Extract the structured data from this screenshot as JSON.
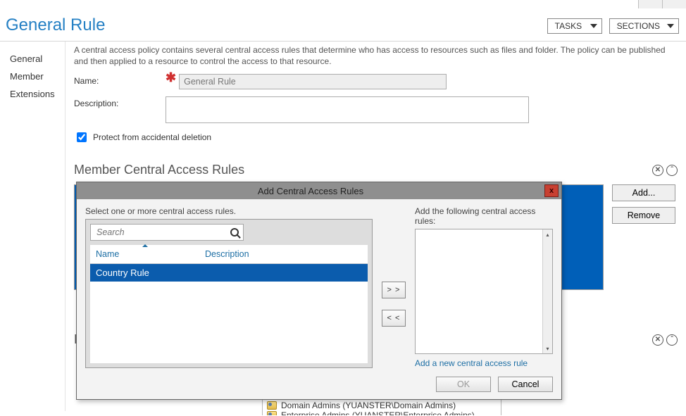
{
  "header": {
    "title": "General Rule",
    "tasks_label": "TASKS",
    "sections_label": "SECTIONS"
  },
  "sidebar": {
    "items": [
      {
        "label": "General"
      },
      {
        "label": "Member"
      },
      {
        "label": "Extensions"
      }
    ]
  },
  "general": {
    "intro": "A central access policy contains several central access rules that determine who has access to resources such as files and folder. The policy can be published and then applied to a resource to control the access to that resource.",
    "name_label": "Name:",
    "name_value": "General Rule",
    "desc_label": "Description:",
    "desc_value": "",
    "protect_label": "Protect from accidental deletion",
    "protect_checked": true
  },
  "member_section": {
    "title": "Member Central Access Rules",
    "add_btn": "Add...",
    "remove_btn": "Remove"
  },
  "ext_section": {
    "title_fragment": "Ex"
  },
  "dialog": {
    "title": "Add Central Access Rules",
    "left_label": "Select one or more central access rules.",
    "right_label": "Add the following central access rules:",
    "search_placeholder": "Search",
    "columns": {
      "name": "Name",
      "description": "Description"
    },
    "rows": [
      {
        "name": "Country Rule",
        "description": ""
      }
    ],
    "move_right": "> >",
    "move_left": "< <",
    "add_link": "Add a new central access rule",
    "ok": "OK",
    "cancel": "Cancel"
  },
  "background_leak": {
    "row1": "Domain Admins (YUANSTER\\Domain Admins)",
    "row2": "Enterprise Admins (YUANSTER\\Enterprise Admins)"
  }
}
